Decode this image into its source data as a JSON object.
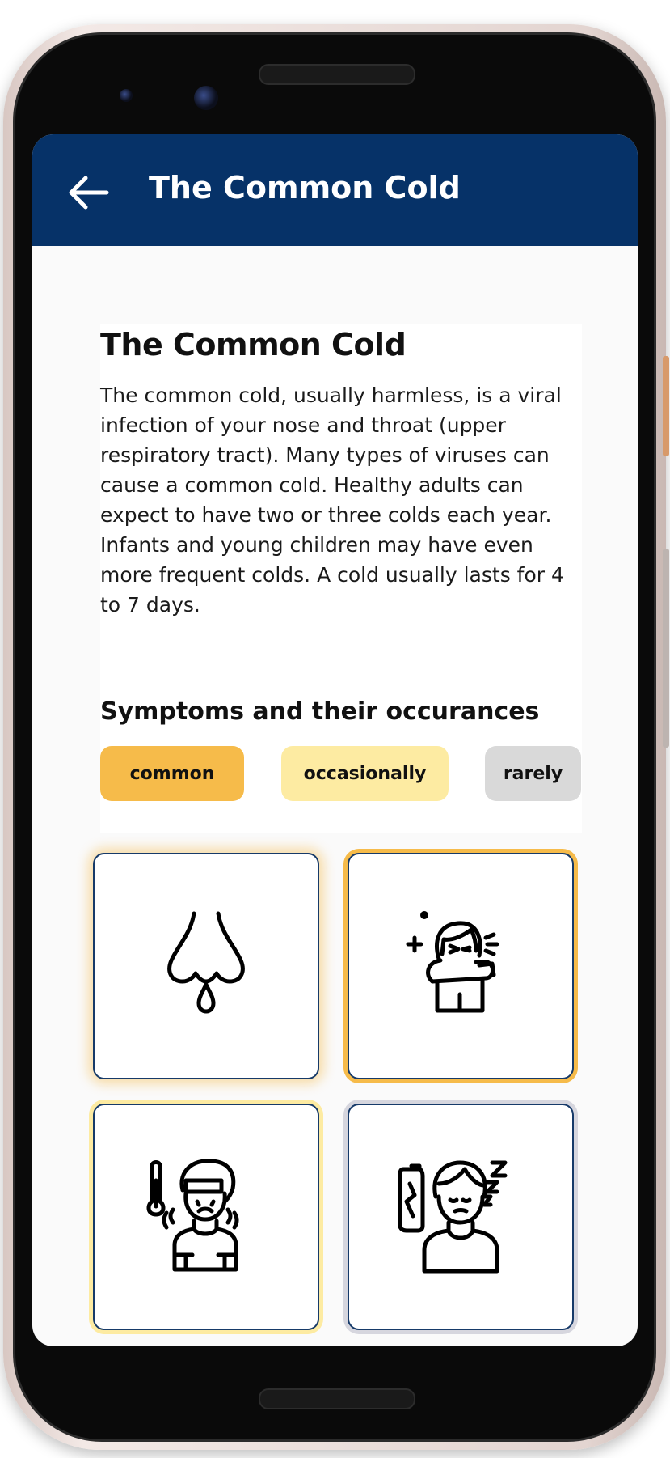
{
  "appbar": {
    "title": "The Common Cold",
    "back_icon": "arrow-left-icon"
  },
  "article": {
    "title": "The Common Cold",
    "description": "The common cold, usually harmless, is a viral infection of your nose and throat (upper respiratory tract). Many types of viruses can cause a common cold. Healthy adults can expect to have two or three colds each year. Infants and young children may have even more frequent colds. A cold usually lasts for 4 to 7 days."
  },
  "symptoms": {
    "title": "Symptoms and their occurances",
    "legend": [
      {
        "label": "common",
        "color": "#f6bb4a"
      },
      {
        "label": "occasionally",
        "color": "#fdeba2"
      },
      {
        "label": "rarely",
        "color": "#d9d9d9"
      }
    ],
    "tiles": [
      {
        "icon": "runny-nose-icon",
        "occurrence": "common"
      },
      {
        "icon": "sneezing-icon",
        "occurrence": "common"
      },
      {
        "icon": "fever-icon",
        "occurrence": "occasionally"
      },
      {
        "icon": "fatigue-icon",
        "occurrence": "rarely"
      }
    ]
  },
  "colors": {
    "appbar": "#063268",
    "tile_border": "#163a69"
  }
}
